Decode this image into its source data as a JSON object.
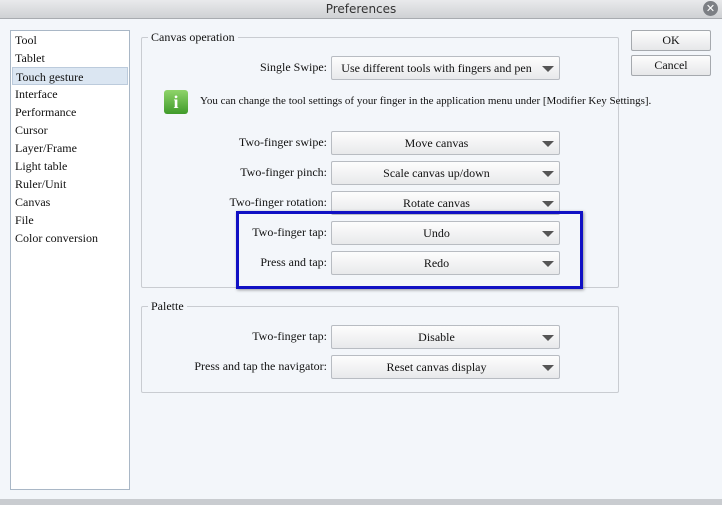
{
  "window": {
    "title": "Preferences"
  },
  "sidebar": {
    "items": [
      {
        "label": "Tool"
      },
      {
        "label": "Tablet"
      },
      {
        "label": "Touch gesture",
        "selected": true
      },
      {
        "label": "Interface"
      },
      {
        "label": "Performance"
      },
      {
        "label": "Cursor"
      },
      {
        "label": "Layer/Frame"
      },
      {
        "label": "Light table"
      },
      {
        "label": "Ruler/Unit"
      },
      {
        "label": "Canvas"
      },
      {
        "label": "File"
      },
      {
        "label": "Color conversion"
      }
    ]
  },
  "buttons": {
    "ok": "OK",
    "cancel": "Cancel"
  },
  "canvas_operation": {
    "title": "Canvas operation",
    "single_swipe": {
      "label": "Single Swipe:",
      "value": "Use different tools with fingers and pen"
    },
    "info_text": "You can change the tool settings of your finger in the application menu under [Modifier Key Settings].",
    "rows": [
      {
        "label": "Two-finger swipe:",
        "value": "Move canvas"
      },
      {
        "label": "Two-finger pinch:",
        "value": "Scale canvas up/down"
      },
      {
        "label": "Two-finger rotation:",
        "value": "Rotate canvas"
      },
      {
        "label": "Two-finger tap:",
        "value": "Undo"
      },
      {
        "label": "Press and tap:",
        "value": "Redo"
      }
    ]
  },
  "palette": {
    "title": "Palette",
    "rows": [
      {
        "label": "Two-finger tap:",
        "value": "Disable"
      },
      {
        "label": "Press and tap the navigator:",
        "value": "Reset canvas display"
      }
    ]
  },
  "highlight_color": "#1010c4"
}
